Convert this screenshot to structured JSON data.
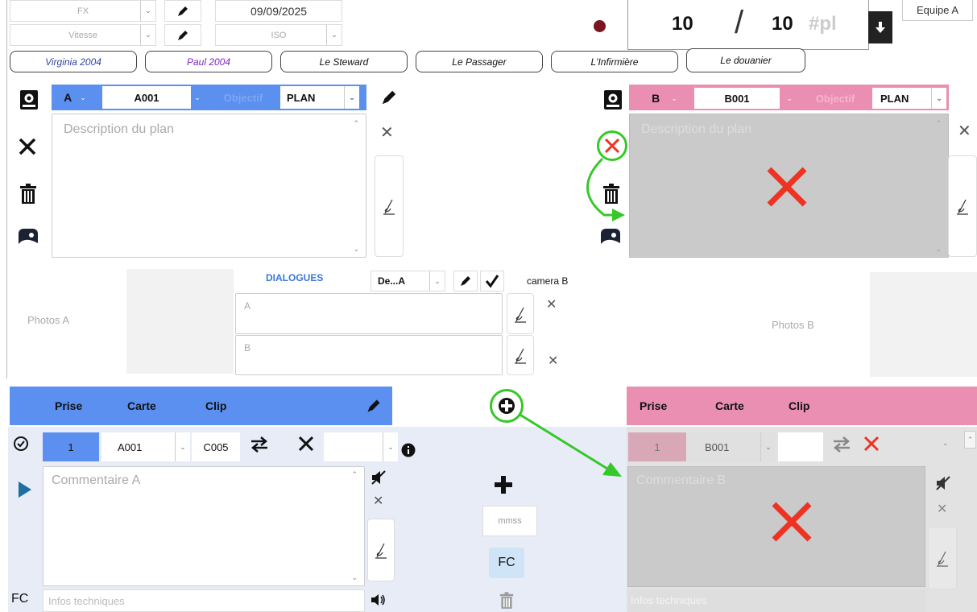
{
  "top": {
    "fx": "FX",
    "vitesse": "Vitesse",
    "date": "09/09/2025",
    "iso": "ISO",
    "counter_current": "10",
    "counter_sep": "/",
    "counter_total": "10",
    "counter_unit": "#pl",
    "team": "Equipe A"
  },
  "characters": [
    "Virginia 2004",
    "Paul 2004",
    "Le Steward",
    "Le Passager",
    "L'Infirmière",
    "Le douanier"
  ],
  "panel_a": {
    "letter": "A",
    "code": "A001",
    "objectif": "Objectif",
    "plan": "PLAN",
    "description_placeholder": "Description du plan"
  },
  "panel_b": {
    "letter": "B",
    "code": "B001",
    "objectif": "Objectif",
    "plan": "PLAN",
    "description_placeholder": "Description du plan"
  },
  "dialogues": {
    "title": "DIALOGUES",
    "select": "De...A",
    "camera": "camera B",
    "line_a": "A",
    "line_b": "B"
  },
  "photos": {
    "a": "Photos A",
    "b": "Photos B"
  },
  "take_a": {
    "col_prise": "Prise",
    "col_carte": "Carte",
    "col_clip": "Clip",
    "prise": "1",
    "carte": "A001",
    "clip": "C005",
    "comment_placeholder": "Commentaire A",
    "fc": "FC",
    "infos_placeholder": "Infos techniques"
  },
  "take_b": {
    "col_prise": "Prise",
    "col_carte": "Carte",
    "col_clip": "Clip",
    "prise": "1",
    "carte": "B001",
    "comment_placeholder": "Commentaire B",
    "infos_placeholder": "Infos techniques"
  },
  "middle": {
    "mmss_placeholder": "mmss",
    "fc": "FC"
  },
  "colors": {
    "blue": "#5b8ff0",
    "pink": "#ea8fb2",
    "green": "#36c828",
    "red": "#ee3323"
  }
}
